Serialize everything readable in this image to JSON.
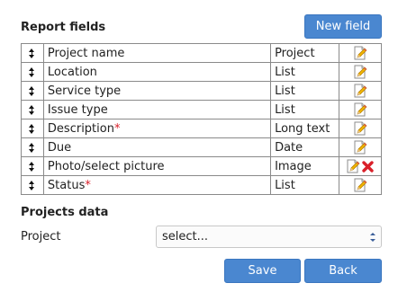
{
  "report_fields": {
    "title": "Report fields",
    "new_field_label": "New field",
    "rows": [
      {
        "name": "Project name",
        "required": "",
        "type": "Project",
        "deletable": false
      },
      {
        "name": "Location",
        "required": "",
        "type": "List",
        "deletable": false
      },
      {
        "name": "Service type",
        "required": "",
        "type": "List",
        "deletable": false
      },
      {
        "name": "Issue type",
        "required": "",
        "type": "List",
        "deletable": false
      },
      {
        "name": "Description",
        "required": "*",
        "type": "Long text",
        "deletable": false
      },
      {
        "name": "Due",
        "required": "",
        "type": "Date",
        "deletable": false
      },
      {
        "name": "Photo/select picture",
        "required": "",
        "type": "Image",
        "deletable": true
      },
      {
        "name": "Status",
        "required": "*",
        "type": "List",
        "deletable": false
      }
    ]
  },
  "projects_data": {
    "title": "Projects data",
    "project_label": "Project",
    "project_select_value": "select..."
  },
  "actions": {
    "save_label": "Save",
    "back_label": "Back"
  },
  "icons": {
    "drag": "drag-handle-icon",
    "edit": "edit-pencil-icon",
    "delete": "delete-x-icon"
  },
  "colors": {
    "button_blue": "#4a87d0",
    "required_red": "#d9202a",
    "delete_red": "#d9202a"
  }
}
